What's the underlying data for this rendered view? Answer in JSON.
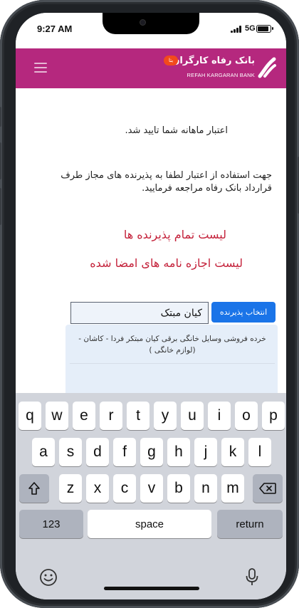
{
  "status_bar": {
    "time": "9:27 AM",
    "network": "5G"
  },
  "header": {
    "bank_name_fa": "بانک رفاه کارگران",
    "bank_name_en": "REFAH KARGARAN BANK",
    "beta_badge": "بتا",
    "brand_color": "#b5287e"
  },
  "content": {
    "message_approved": "اعتبار ماهانه شما تایید شد.",
    "message_instruction": "جهت استفاده از اعتبار لطفا به پذیرنده های مجاز طرف قرارداد بانک رفاه مراجعه فرمایید.",
    "link_all_merchants": "لیست تمام پذیرنده ها",
    "link_signed_permits": "لیست اجازه نامه های امضا شده",
    "link_color": "#c4213a"
  },
  "search": {
    "select_button_label": "انتخاب پذیرنده",
    "input_value": "کیان مبتک",
    "results": [
      "خرده فروشی وسایل خانگی برقی کیان مبتکر فردا - کاشان - (لوازم خانگی )"
    ]
  },
  "keyboard": {
    "row1": [
      "q",
      "w",
      "e",
      "r",
      "t",
      "y",
      "u",
      "i",
      "o",
      "p"
    ],
    "row2": [
      "a",
      "s",
      "d",
      "f",
      "g",
      "h",
      "j",
      "k",
      "l"
    ],
    "row3": [
      "z",
      "x",
      "c",
      "v",
      "b",
      "n",
      "m"
    ],
    "numbers_key": "123",
    "space_key": "space",
    "return_key": "return"
  }
}
